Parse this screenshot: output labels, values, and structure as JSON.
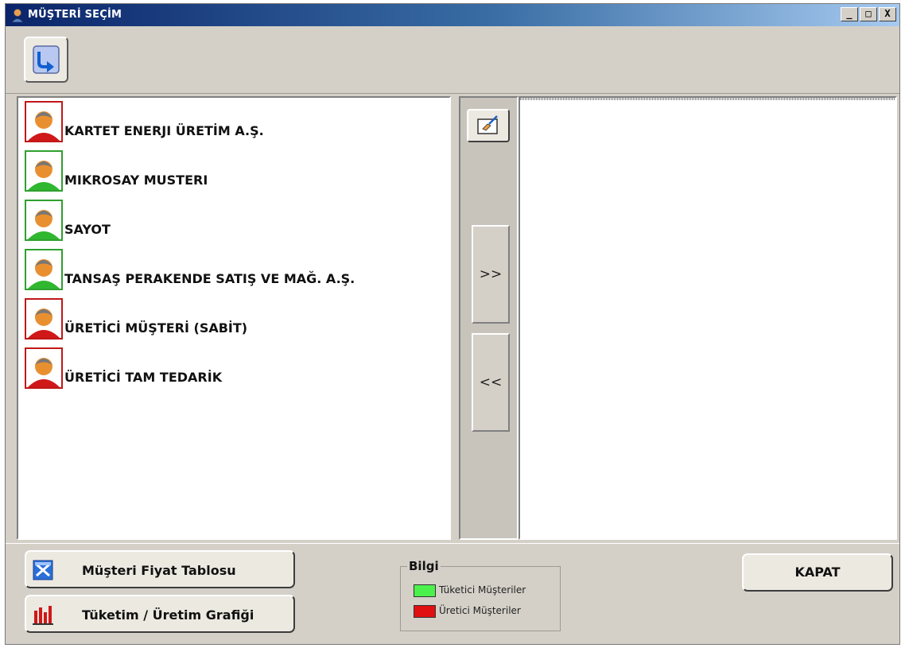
{
  "window": {
    "title": "MÜŞTERİ SEÇİM",
    "controls": [
      "_",
      "□",
      "X"
    ]
  },
  "colors": {
    "consumer": "#2fb72f",
    "producer": "#d01818",
    "consumer_legend": "#4cf04c",
    "producer_legend": "#e01010"
  },
  "toolbar": {
    "refresh_icon": "refresh-arrow-icon"
  },
  "customers": [
    {
      "name": "KARTET ENERJI ÜRETİM A.Ş.",
      "type": "producer"
    },
    {
      "name": "MIKROSAY MUSTERI",
      "type": "consumer"
    },
    {
      "name": "SAYOT",
      "type": "consumer"
    },
    {
      "name": "TANSAŞ PERAKENDE SATIŞ VE MAĞ. A.Ş.",
      "type": "consumer"
    },
    {
      "name": "ÜRETİCİ MÜŞTERİ (SABİT)",
      "type": "producer"
    },
    {
      "name": "ÜRETİCİ TAM TEDARİK",
      "type": "producer"
    }
  ],
  "middle": {
    "add_label": ">>",
    "remove_label": "<<",
    "clear_icon": "eraser-icon"
  },
  "bottom": {
    "price_table_label": "Müşteri Fiyat Tablosu",
    "chart_label": "Tüketim / Üretim Grafiği",
    "close_label": "KAPAT",
    "legend": {
      "title": "Bilgi",
      "consumer_label": "Tüketici Müşteriler",
      "producer_label": "Üretici Müşteriler"
    }
  }
}
